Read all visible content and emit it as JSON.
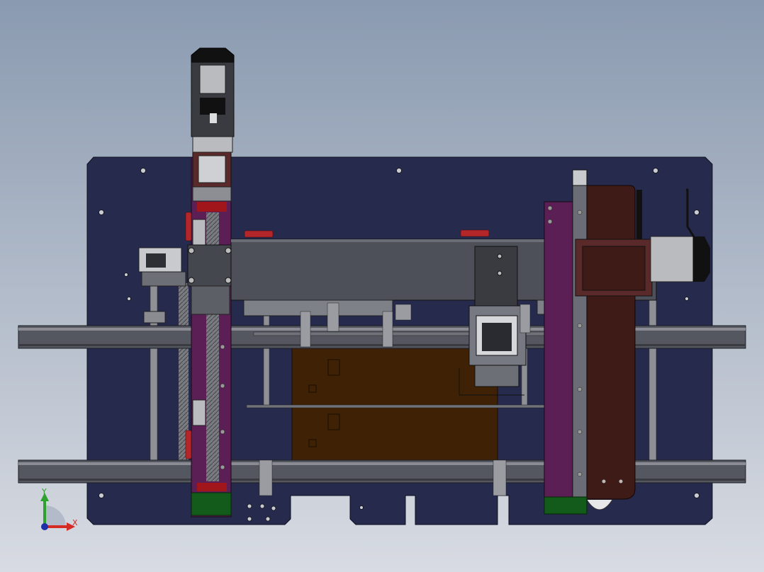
{
  "viewport": {
    "background_top": "#8a9ab0",
    "background_bottom": "#d8dbe2"
  },
  "colors": {
    "base_plate": "#262a4c",
    "rail": "#545660",
    "rail_highlight": "#8a8b93",
    "column_purple": "#5b1f55",
    "motor_dark": "#3a3b40",
    "motor_light": "#b9bbbe",
    "beam_gray": "#4e5059",
    "box_brown": "#3f2205",
    "belt_brown": "#3e1b16",
    "green_block": "#125b1a",
    "red_clamp": "#b3262a",
    "shaft_gray": "#8e9096",
    "axis_x": "#d42b25",
    "axis_y": "#2fa12f",
    "axis_origin": "#1f2fa8"
  },
  "triad": {
    "x_label": "X",
    "y_label": "Y",
    "x_icon": "x-axis-arrow-icon",
    "y_icon": "y-axis-arrow-icon"
  }
}
